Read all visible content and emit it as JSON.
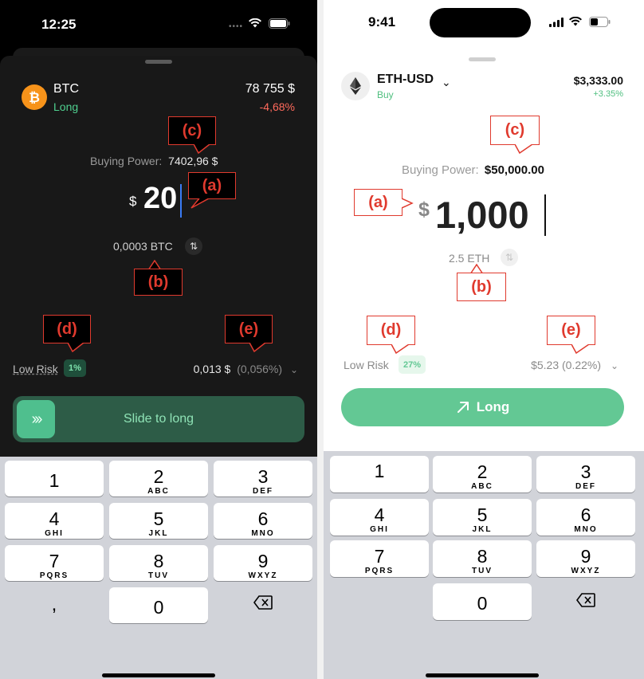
{
  "left_screen": {
    "time": "12:25",
    "asset": {
      "symbol": "BTC",
      "side": "Long",
      "price": "78 755 $",
      "change": "-4,68%",
      "icon": "bitcoin-icon"
    },
    "buying_power_label": "Buying Power:",
    "buying_power_value": "7402,96 $",
    "currency_symbol": "$",
    "amount": "20",
    "conversion": "0,0003 BTC",
    "risk_label": "Low Risk",
    "risk_badge": "1%",
    "fee": "0,013 $",
    "fee_pct": "(0,056%)",
    "slide_label": "Slide to long",
    "callouts": {
      "a": "(a)",
      "b": "(b)",
      "c": "(c)",
      "d": "(d)",
      "e": "(e)"
    },
    "colors": {
      "positive": "#4fd08f",
      "negative": "#ff6a5c",
      "slider": "#2d5c47"
    }
  },
  "right_screen": {
    "time": "9:41",
    "asset": {
      "symbol": "ETH-USD",
      "side": "Buy",
      "price": "$3,333.00",
      "change": "+3.35%",
      "icon": "ethereum-icon"
    },
    "buying_power_label": "Buying Power:",
    "buying_power_value": "$50,000.00",
    "currency_symbol": "$",
    "amount": "1,000",
    "conversion": "2.5 ETH",
    "risk_label": "Low Risk",
    "risk_badge": "27%",
    "fee": "$5.23 (0.22%)",
    "button_label": "Long",
    "callouts": {
      "a": "(a)",
      "b": "(b)",
      "c": "(c)",
      "d": "(d)",
      "e": "(e)"
    },
    "colors": {
      "positive": "#4fbf7f",
      "button": "#63c894"
    }
  },
  "keypad": [
    {
      "num": "1",
      "letters": ""
    },
    {
      "num": "2",
      "letters": "ABC"
    },
    {
      "num": "3",
      "letters": "DEF"
    },
    {
      "num": "4",
      "letters": "GHI"
    },
    {
      "num": "5",
      "letters": "JKL"
    },
    {
      "num": "6",
      "letters": "MNO"
    },
    {
      "num": "7",
      "letters": "PQRS"
    },
    {
      "num": "8",
      "letters": "TUV"
    },
    {
      "num": "9",
      "letters": "WXYZ"
    },
    {
      "num": "0",
      "letters": ""
    }
  ],
  "keypad_left_extra": ",",
  "backspace_icon": "backspace-icon"
}
